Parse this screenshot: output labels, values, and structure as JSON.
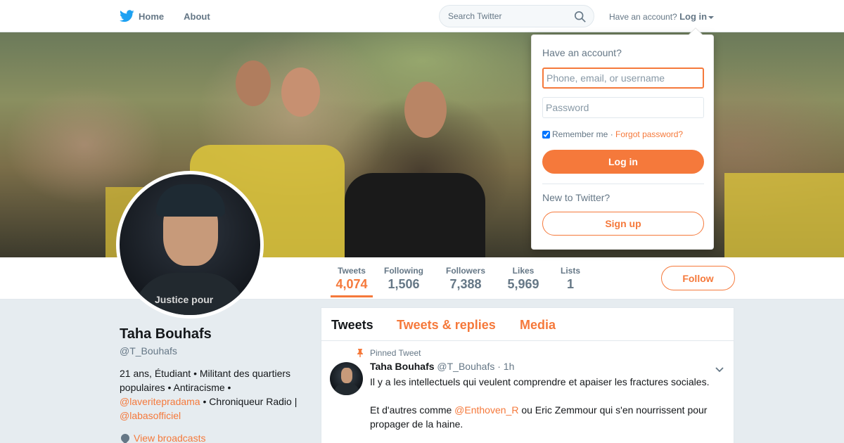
{
  "nav": {
    "home_label": "Home",
    "about_label": "About",
    "search_placeholder": "Search Twitter",
    "have_account": "Have an account?",
    "login_label": "Log in"
  },
  "profile": {
    "name": "Taha Bouhafs",
    "handle": "@T_Bouhafs",
    "bio_part1": "21 ans, Étudiant • Militant des quartiers populaires • Antiracisme •",
    "bio_link1": "@laveritepradama",
    "bio_part2": "• Chroniqueur Radio |",
    "bio_link2": "@labasofficiel",
    "broadcasts_label": "View broadcasts",
    "avatar_shirt_text": "Justice pour"
  },
  "stats": [
    {
      "label": "Tweets",
      "value": "4,074"
    },
    {
      "label": "Following",
      "value": "1,506"
    },
    {
      "label": "Followers",
      "value": "7,388"
    },
    {
      "label": "Likes",
      "value": "5,969"
    },
    {
      "label": "Lists",
      "value": "1"
    }
  ],
  "follow_label": "Follow",
  "timeline": {
    "tabs": [
      "Tweets",
      "Tweets & replies",
      "Media"
    ],
    "pinned_label": "Pinned Tweet",
    "tweet": {
      "name": "Taha Bouhafs",
      "handle_time": "@T_Bouhafs · 1h",
      "line1": "Il y a les intellectuels qui veulent comprendre et apaiser les fractures sociales.",
      "line2_pre": "Et d'autres comme",
      "line2_link": "@Enthoven_R",
      "line2_post": "ou Eric Zemmour qui s'en nourrissent pour propager de la haine."
    }
  },
  "login_dropdown": {
    "title": "Have an account?",
    "username_placeholder": "Phone, email, or username",
    "password_placeholder": "Password",
    "remember_label": "Remember me",
    "separator": "·",
    "forgot_label": "Forgot password?",
    "login_button": "Log in",
    "new_to_twitter": "New to Twitter?",
    "signup_button": "Sign up"
  },
  "colors": {
    "accent": "#f5793b",
    "text": "#14171a",
    "muted": "#657786",
    "twitter_blue": "#1da1f2",
    "background": "#e6ecf0"
  }
}
